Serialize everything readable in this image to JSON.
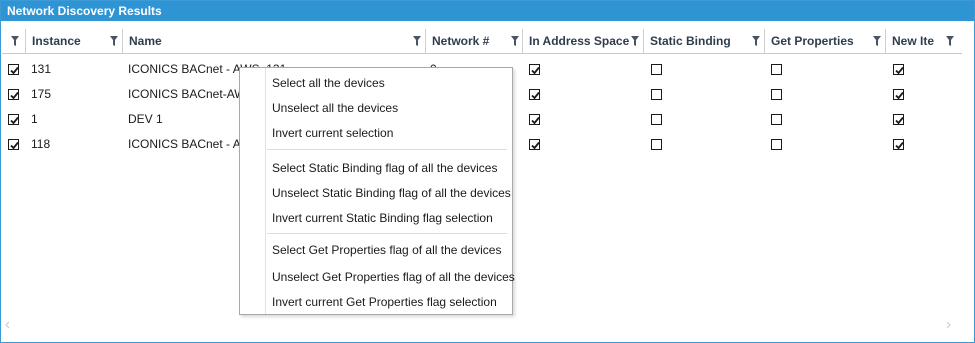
{
  "window": {
    "title": "Network Discovery Results"
  },
  "columns": [
    {
      "label": "Instance"
    },
    {
      "label": "Name"
    },
    {
      "label": "Network #"
    },
    {
      "label": "In Address Space"
    },
    {
      "label": "Static Binding"
    },
    {
      "label": "Get Properties"
    },
    {
      "label": "New Ite"
    }
  ],
  "rows": [
    {
      "selected": true,
      "instance": "131",
      "name": "ICONICS BACnet - AWS_131",
      "network": "0",
      "in_address_space": true,
      "static_binding": false,
      "get_properties": false,
      "new_item": true
    },
    {
      "selected": true,
      "instance": "175",
      "name": "ICONICS BACnet-AWS",
      "network": "",
      "in_address_space": true,
      "static_binding": false,
      "get_properties": false,
      "new_item": true
    },
    {
      "selected": true,
      "instance": "1",
      "name": "DEV 1",
      "network": "",
      "in_address_space": true,
      "static_binding": false,
      "get_properties": false,
      "new_item": true
    },
    {
      "selected": true,
      "instance": "118",
      "name": "ICONICS BACnet - AW",
      "network": "",
      "in_address_space": true,
      "static_binding": false,
      "get_properties": false,
      "new_item": true
    }
  ],
  "context_menu": {
    "groups": [
      [
        "Select all the devices",
        "Unselect all the devices",
        "Invert current selection"
      ],
      [
        "Select Static Binding flag of all the devices",
        "Unselect Static Binding flag of all the devices",
        "Invert current Static Binding flag selection"
      ],
      [
        "Select Get Properties flag of all the devices",
        "Unselect Get Properties flag of all the devices",
        "Invert current Get Properties flag selection"
      ]
    ]
  },
  "icons": {
    "filter": "filter-icon",
    "checkmark": "checkmark-icon",
    "scroll_left": "chevron-left-icon",
    "scroll_right": "chevron-right-icon"
  },
  "colors": {
    "titlebar": "#2f94d4",
    "border": "#3c9ad6",
    "header_text": "#2f3d4d"
  }
}
